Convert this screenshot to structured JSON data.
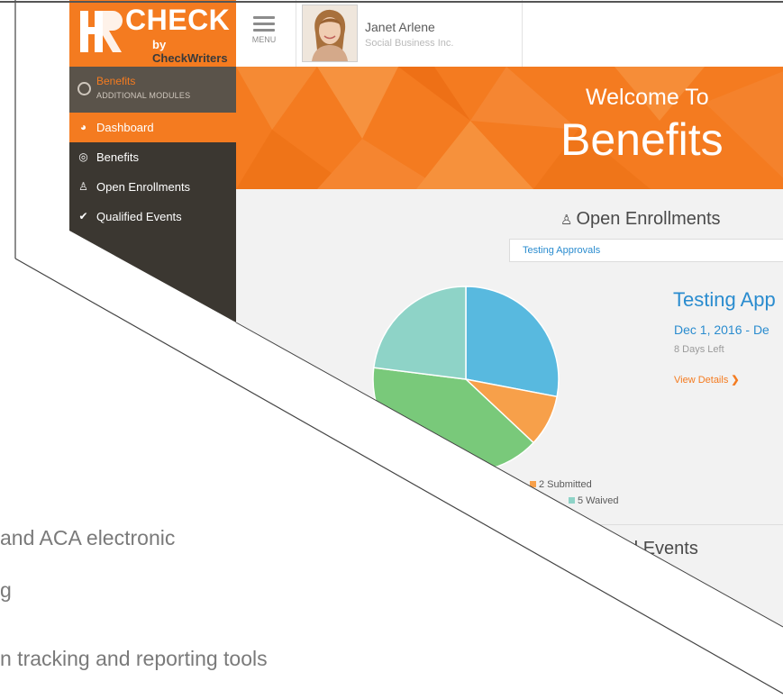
{
  "header": {
    "logo": {
      "brand": "CHECK",
      "by": "by",
      "parent": "CheckWriters"
    },
    "menu_label": "MENU",
    "user": {
      "name": "Janet Arlene",
      "company": "Social Business Inc."
    }
  },
  "sidebar": {
    "module": {
      "title": "Benefits",
      "subtitle": "ADDITIONAL MODULES"
    },
    "items": [
      {
        "label": "Dashboard",
        "icon": "pie-chart-icon",
        "active": true
      },
      {
        "label": "Benefits",
        "icon": "compass-icon",
        "active": false
      },
      {
        "label": "Open Enrollments",
        "icon": "person-icon",
        "active": false
      },
      {
        "label": "Qualified Events",
        "icon": "checkmark-icon",
        "active": false
      }
    ]
  },
  "banner": {
    "welcome": "Welcome To",
    "title": "Benefits"
  },
  "open_enrollments": {
    "heading": "Open Enrollments",
    "selected": "Testing Approvals",
    "enrollment_title": "Testing App",
    "dates": "Dec 1, 2016 - De",
    "days_left": "8 Days Left",
    "view_details": "View Details",
    "legend": [
      {
        "label": "2 Submitted",
        "color": "#f7a04a"
      },
      {
        "label": "5 Waived",
        "color": "#8ed3c7"
      }
    ]
  },
  "qualified_events": {
    "heading": "lified Events"
  },
  "marketing": {
    "line1": "and ACA electronic",
    "line2": "g",
    "line3": "n tracking and reporting tools"
  },
  "colors": {
    "brand_orange": "#f47b20",
    "sidebar": "#3b3731",
    "link_blue": "#2a8ccf"
  },
  "chart_data": {
    "type": "pie",
    "categories": [
      "blue",
      "Submitted",
      "green",
      "Waived"
    ],
    "values": [
      28,
      9,
      40,
      23
    ],
    "colors": [
      "#58b9df",
      "#f7a04a",
      "#79c97a",
      "#8ed3c7"
    ]
  }
}
